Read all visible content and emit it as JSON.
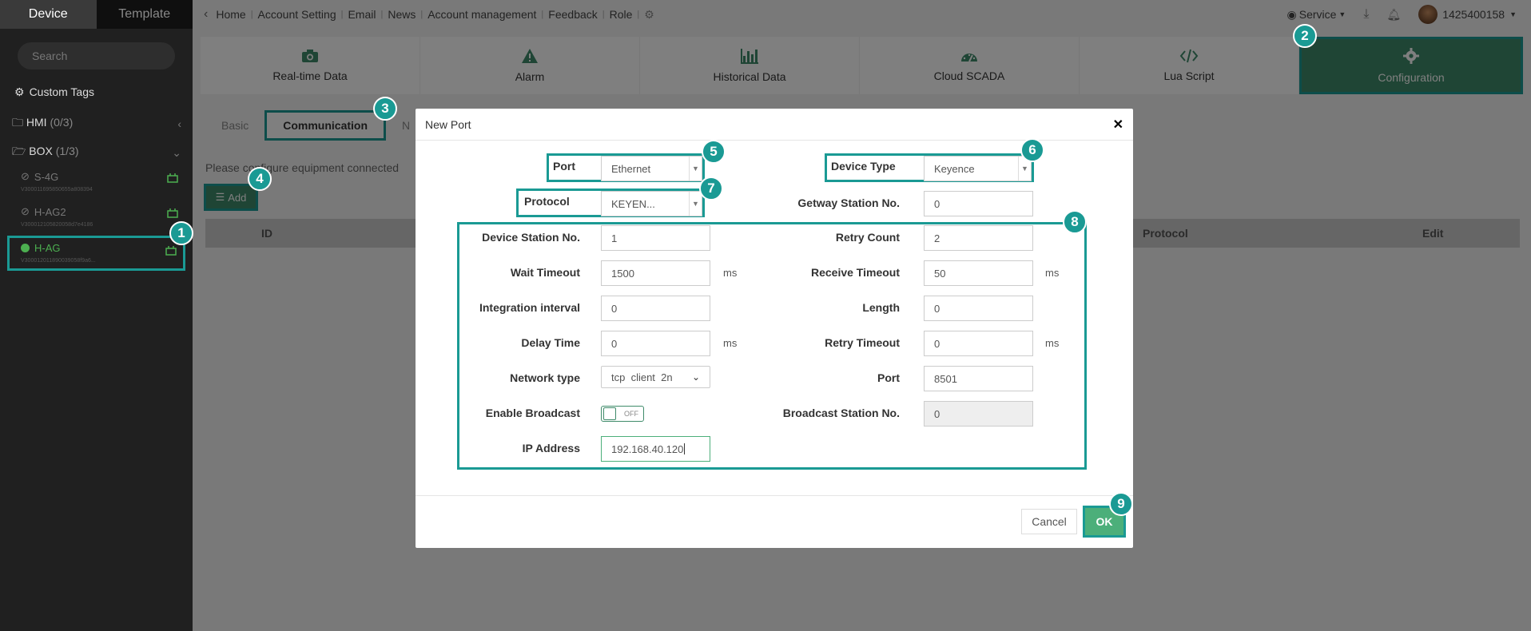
{
  "sidebar": {
    "tabs": [
      "Device",
      "Template"
    ],
    "search_placeholder": "Search",
    "custom_tags": "Custom Tags",
    "groups": [
      {
        "label": "HMI",
        "count": "(0/3)"
      },
      {
        "label": "BOX",
        "count": "(1/3)"
      }
    ],
    "devices": [
      {
        "name": "S-4G",
        "sub": "V300011695850655a808394"
      },
      {
        "name": "H-AG2",
        "sub": "V300012105820058d7e4186"
      },
      {
        "name": "H-AG",
        "sub": "V300012011890039058f9a6..."
      }
    ]
  },
  "topbar": {
    "crumbs": [
      "Home",
      "Account Setting",
      "Email",
      "News",
      "Account management",
      "Feedback",
      "Role"
    ],
    "service": "Service",
    "user": "1425400158"
  },
  "modules": [
    {
      "label": "Real-time Data",
      "icon": "camera-icon"
    },
    {
      "label": "Alarm",
      "icon": "warning-icon"
    },
    {
      "label": "Historical Data",
      "icon": "bar-chart-icon"
    },
    {
      "label": "Cloud SCADA",
      "icon": "dashboard-icon"
    },
    {
      "label": "Lua Script",
      "icon": "code-icon"
    },
    {
      "label": "Configuration",
      "icon": "gear-icon"
    }
  ],
  "content": {
    "tabs": [
      "Basic",
      "Communication",
      "N"
    ],
    "hint": "Please configure equipment connected",
    "add_label": "Add",
    "grid_headers": [
      "ID",
      "Protocol",
      "Edit"
    ]
  },
  "modal": {
    "title": "New Port",
    "port_label": "Port",
    "port_value": "Ethernet",
    "device_type_label": "Device Type",
    "device_type_value": "Keyence",
    "protocol_label": "Protocol",
    "protocol_value": "KEYEN...",
    "gateway_label": "Getway Station No.",
    "gateway_value": "0",
    "device_station_label": "Device Station No.",
    "device_station_value": "1",
    "retry_count_label": "Retry Count",
    "retry_count_value": "2",
    "wait_timeout_label": "Wait Timeout",
    "wait_timeout_value": "1500",
    "receive_timeout_label": "Receive Timeout",
    "receive_timeout_value": "50",
    "integration_label": "Integration interval",
    "integration_value": "0",
    "length_label": "Length",
    "length_value": "0",
    "delay_label": "Delay Time",
    "delay_value": "0",
    "retry_timeout_label": "Retry Timeout",
    "retry_timeout_value": "0",
    "network_type_label": "Network type",
    "network_type_value": "tcp  client  2n",
    "net_port_label": "Port",
    "net_port_value": "8501",
    "broadcast_label": "Enable Broadcast",
    "broadcast_toggle": "OFF",
    "broadcast_station_label": "Broadcast Station No.",
    "broadcast_station_value": "0",
    "ip_label": "IP Address",
    "ip_value": "192.168.40.120",
    "unit_ms": "ms",
    "cancel": "Cancel",
    "ok": "OK"
  },
  "badges": [
    "1",
    "2",
    "3",
    "4",
    "5",
    "6",
    "7",
    "8",
    "9"
  ],
  "colors": {
    "accent": "#1a9a94",
    "primary": "#3f8b6a",
    "online": "#4caf50"
  }
}
